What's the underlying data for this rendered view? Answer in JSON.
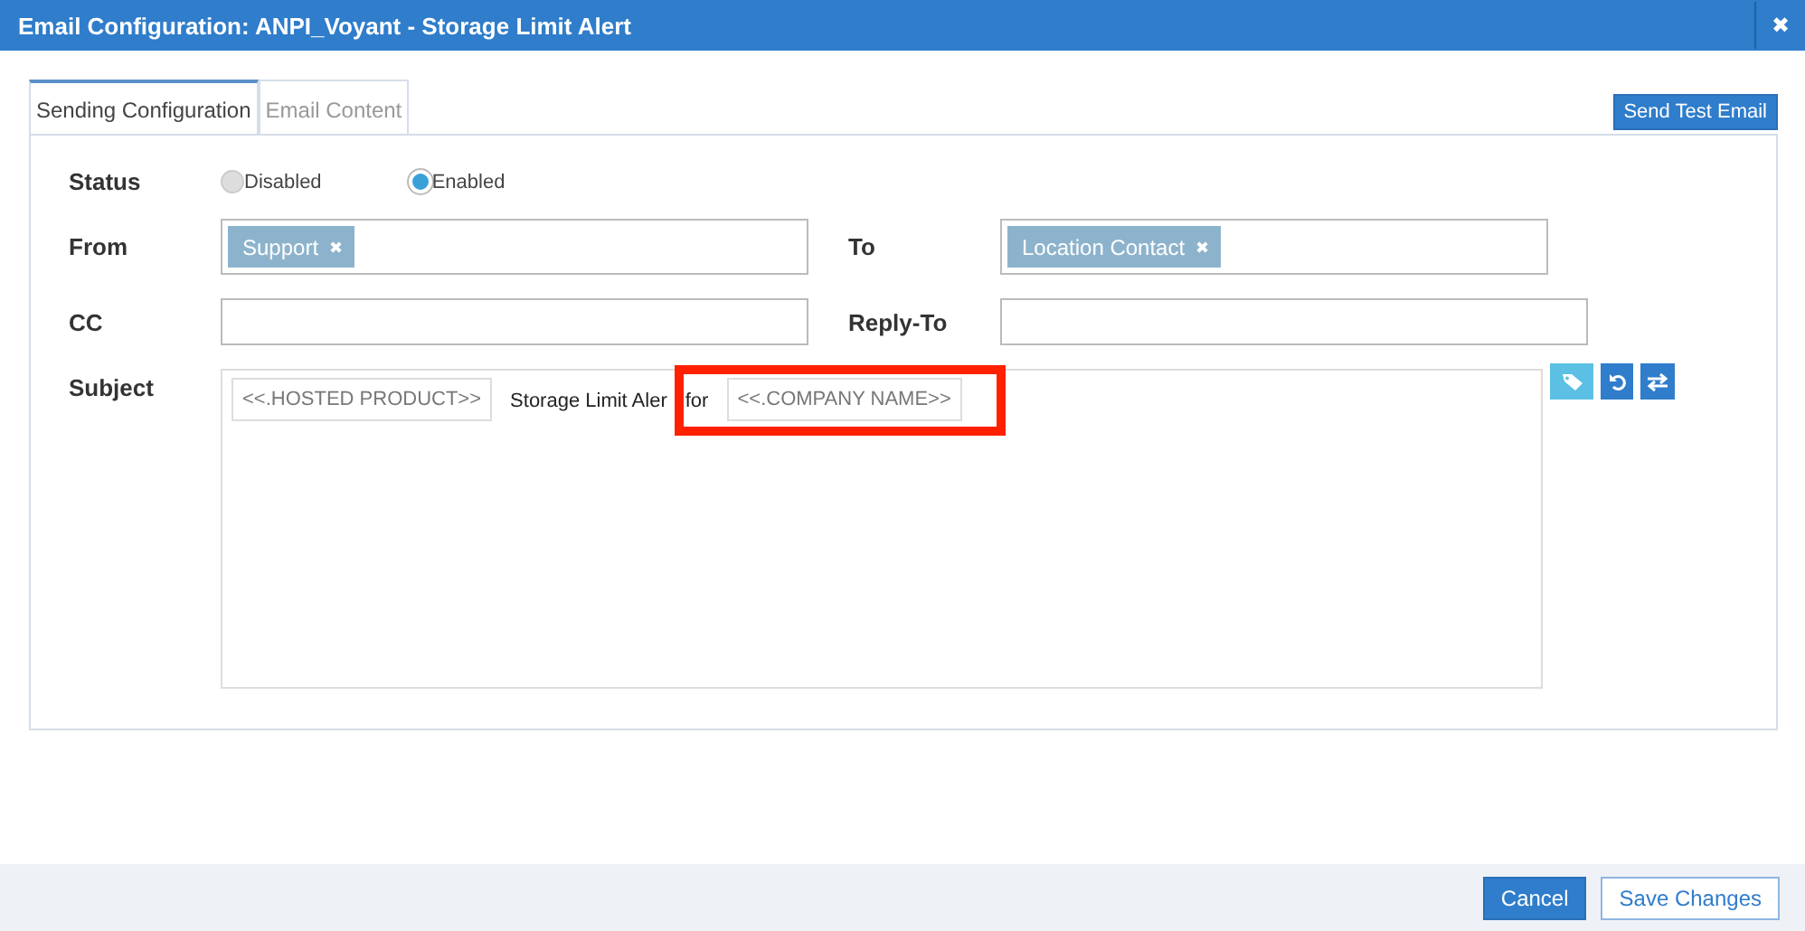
{
  "window": {
    "title": "Email Configuration: ANPI_Voyant - Storage Limit Alert",
    "close": "✖"
  },
  "tabs": [
    {
      "label": "Sending Configuration",
      "selected": true
    },
    {
      "label": "Email Content",
      "selected": false
    }
  ],
  "send_test_button": "Send Test Email",
  "status": {
    "label": "Status",
    "options": [
      {
        "label": "Disabled",
        "selected": false
      },
      {
        "label": "Enabled",
        "selected": true
      }
    ]
  },
  "from": {
    "label": "From",
    "tags": [
      {
        "label": "Support",
        "remove": "✖"
      }
    ]
  },
  "to": {
    "label": "To",
    "tags": [
      {
        "label": "Location Contact",
        "remove": "✖"
      }
    ]
  },
  "cc": {
    "label": "CC"
  },
  "reply_to": {
    "label": "Reply-To"
  },
  "subject": {
    "label": "Subject",
    "parts": [
      {
        "kind": "token",
        "text": "<<.HOSTED PRODUCT>>"
      },
      {
        "kind": "text",
        "text": "Storage Limit Aler"
      },
      {
        "kind": "text",
        "text": "for"
      },
      {
        "kind": "token",
        "text": "<<.COMPANY NAME>>",
        "highlighted": true
      }
    ]
  },
  "footer": {
    "buttons": [
      {
        "label": "Cancel",
        "kind": "primary"
      },
      {
        "label": "Save Changes",
        "kind": "secondary"
      }
    ]
  }
}
